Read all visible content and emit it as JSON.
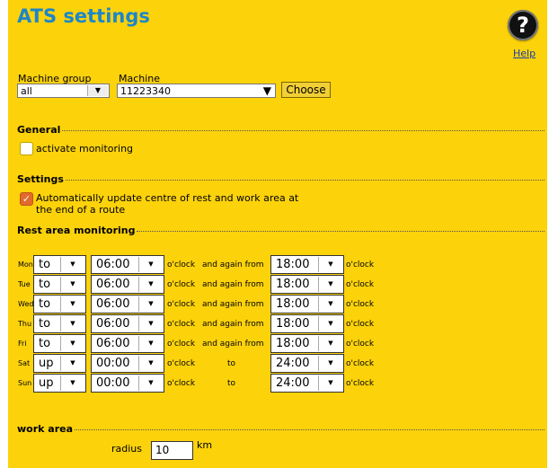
{
  "header": {
    "title": "ATS settings",
    "help_icon": "question-mark-icon",
    "help_label": "Help"
  },
  "machine_selector": {
    "group_label": "Machine group",
    "group_value": "all",
    "machine_label": "Machine",
    "machine_value": "11223340",
    "choose_label": "Choose"
  },
  "general": {
    "title": "General",
    "activate_label": "activate monitoring",
    "activate_checked": false
  },
  "settings": {
    "title": "Settings",
    "auto_update_line1": "Automatically update centre of rest and work area at",
    "auto_update_line2": "the end of a route",
    "auto_update_checked": true
  },
  "rest_area": {
    "title": "Rest area monitoring",
    "oclock": "o'clock",
    "rows": [
      {
        "day": "Mon",
        "mode": "to",
        "start": "06:00",
        "middle": "and again from",
        "end": "18:00"
      },
      {
        "day": "Tue",
        "mode": "to",
        "start": "06:00",
        "middle": "and again from",
        "end": "18:00"
      },
      {
        "day": "Wed",
        "mode": "to",
        "start": "06:00",
        "middle": "and again from",
        "end": "18:00"
      },
      {
        "day": "Thu",
        "mode": "to",
        "start": "06:00",
        "middle": "and again from",
        "end": "18:00"
      },
      {
        "day": "Fri",
        "mode": "to",
        "start": "06:00",
        "middle": "and again from",
        "end": "18:00"
      },
      {
        "day": "Sat",
        "mode": "up",
        "start": "00:00",
        "middle": "to",
        "end": "24:00"
      },
      {
        "day": "Sun",
        "mode": "up",
        "start": "00:00",
        "middle": "to",
        "end": "24:00"
      }
    ]
  },
  "work_area": {
    "title": "work area",
    "radius_label": "radius",
    "radius_value": "10",
    "unit": "km"
  },
  "colors": {
    "panel": "#fcd20b",
    "title": "#1d86c8",
    "checkbox_on": "#e36a2c"
  }
}
